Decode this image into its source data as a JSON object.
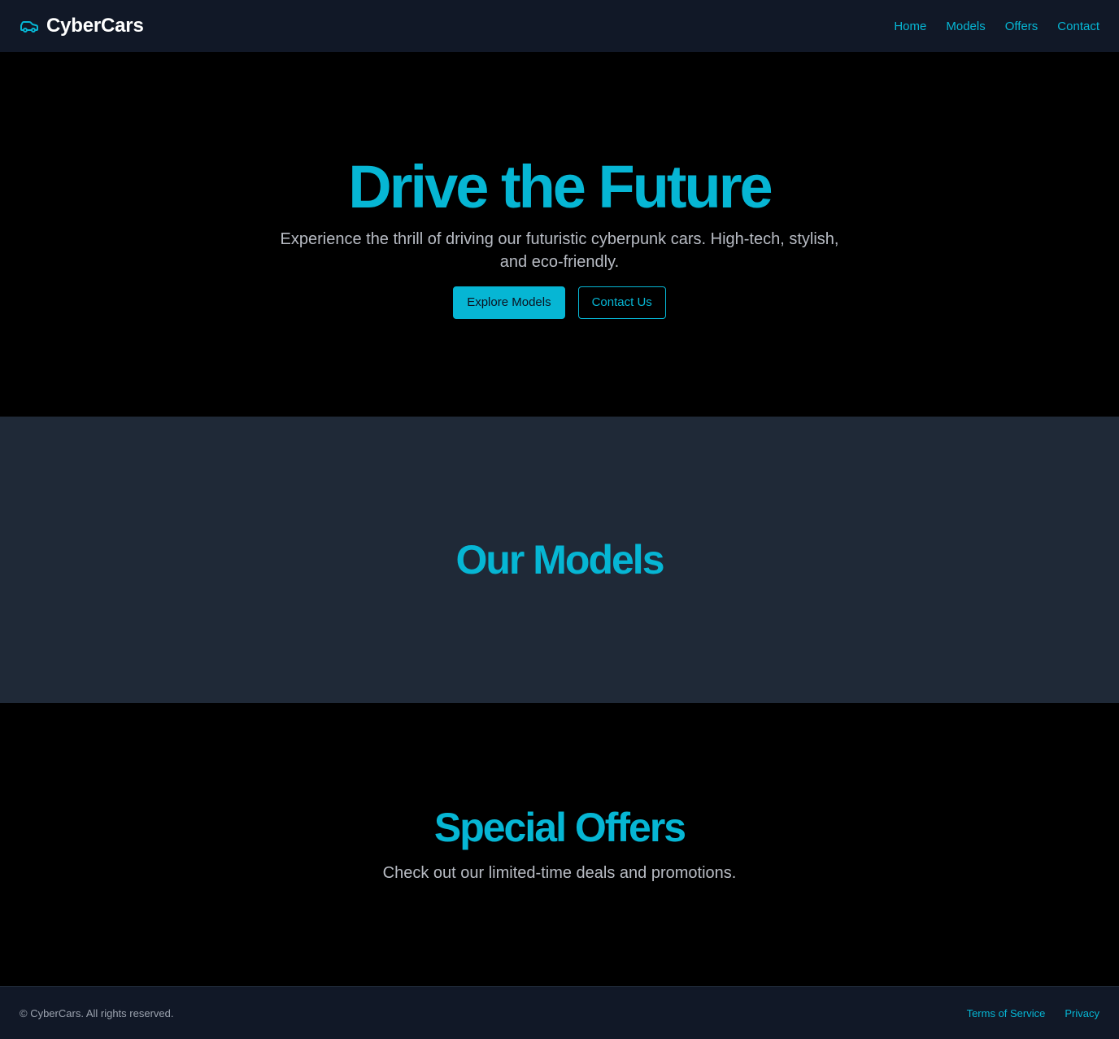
{
  "header": {
    "brand_icon": "car-icon",
    "brand_name": "CyberCars",
    "nav": [
      "Home",
      "Models",
      "Offers",
      "Contact"
    ]
  },
  "hero": {
    "title": "Drive the Future",
    "subtitle": "Experience the thrill of driving our futuristic cyberpunk cars. High-tech, stylish, and eco-friendly.",
    "primary_button": "Explore Models",
    "secondary_button": "Contact Us"
  },
  "models": {
    "title": "Our Models"
  },
  "offers": {
    "title": "Special Offers",
    "subtitle": "Check out our limited-time deals and promotions."
  },
  "footer": {
    "copyright": "© CyberCars. All rights reserved.",
    "links": [
      "Terms of Service",
      "Privacy"
    ]
  },
  "colors": {
    "accent": "#06b6d4",
    "header_bg": "#111827",
    "section_alt_bg": "#1f2937",
    "page_bg": "#000000"
  }
}
